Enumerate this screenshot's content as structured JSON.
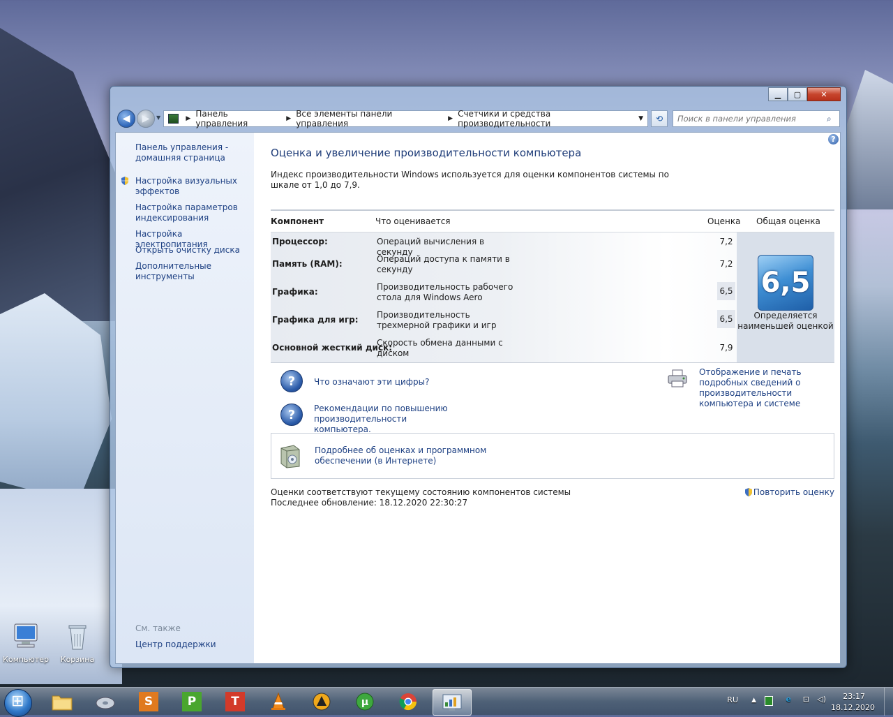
{
  "desktop": {
    "icons": [
      {
        "label": "Компьютер"
      },
      {
        "label": "Корзина"
      }
    ]
  },
  "window": {
    "controls": {
      "minimize": "▁",
      "maximize": "▢",
      "close": "✕"
    },
    "address": {
      "crumbs": [
        "Панель управления",
        "Все элементы панели управления",
        "Счетчики и средства производительности"
      ]
    },
    "search": {
      "placeholder": "Поиск в панели управления"
    }
  },
  "sidebar": {
    "items": [
      {
        "label": "Панель управления - домашняя страница"
      },
      {
        "label": "Настройка визуальных эффектов"
      },
      {
        "label": "Настройка параметров индексирования"
      },
      {
        "label": "Настройка электропитания"
      },
      {
        "label": "Открыть очистку диска"
      },
      {
        "label": "Дополнительные инструменты"
      }
    ],
    "see_also": "См. также",
    "support": "Центр поддержки"
  },
  "main": {
    "title": "Оценка и увеличение производительности компьютера",
    "description": "Индекс производительности Windows используется для оценки компонентов системы по шкале от 1,0 до 7,9.",
    "table": {
      "headers": {
        "component": "Компонент",
        "what": "Что оценивается",
        "score": "Оценка",
        "overall": "Общая оценка"
      },
      "rows": [
        {
          "component": "Процессор:",
          "what": "Операций вычисления в секунду",
          "score": "7,2"
        },
        {
          "component": "Память (RAM):",
          "what": "Операций доступа к памяти в секунду",
          "score": "7,2"
        },
        {
          "component": "Графика:",
          "what": "Производительность рабочего стола для Windows Aero",
          "score": "6,5"
        },
        {
          "component": "Графика для игр:",
          "what": "Производительность трехмерной графики и игр",
          "score": "6,5"
        },
        {
          "component": "Основной жесткий диск:",
          "what": "Скорость обмена данными с диском",
          "score": "7,9"
        }
      ],
      "overall_score": "6,5",
      "overall_note": "Определяется наименьшей оценкой"
    },
    "links": {
      "what_numbers": "Что означают эти цифры?",
      "recommendations": "Рекомендации по повышению производительности компьютера.",
      "print": "Отображение и печать подробных сведений о производительности компьютера и системе",
      "more_info": "Подробнее об оценках и программном обеспечении (в Интернете)"
    },
    "footer": {
      "status": "Оценки соответствуют текущему состоянию компонентов системы",
      "last_update": "Последнее обновление: 18.12.2020 22:30:27",
      "repeat": "Повторить оценку"
    }
  },
  "taskbar": {
    "apps": [
      {
        "name": "explorer"
      },
      {
        "name": "media-center"
      },
      {
        "name": "S",
        "color": "#e07a1f"
      },
      {
        "name": "P",
        "color": "#4aa62f"
      },
      {
        "name": "T",
        "color": "#d23a2a"
      },
      {
        "name": "vlc"
      },
      {
        "name": "aimp"
      },
      {
        "name": "utorrent"
      },
      {
        "name": "chrome"
      },
      {
        "name": "control-panel"
      }
    ],
    "lang": "RU",
    "time": "23:17",
    "date": "18.12.2020"
  }
}
